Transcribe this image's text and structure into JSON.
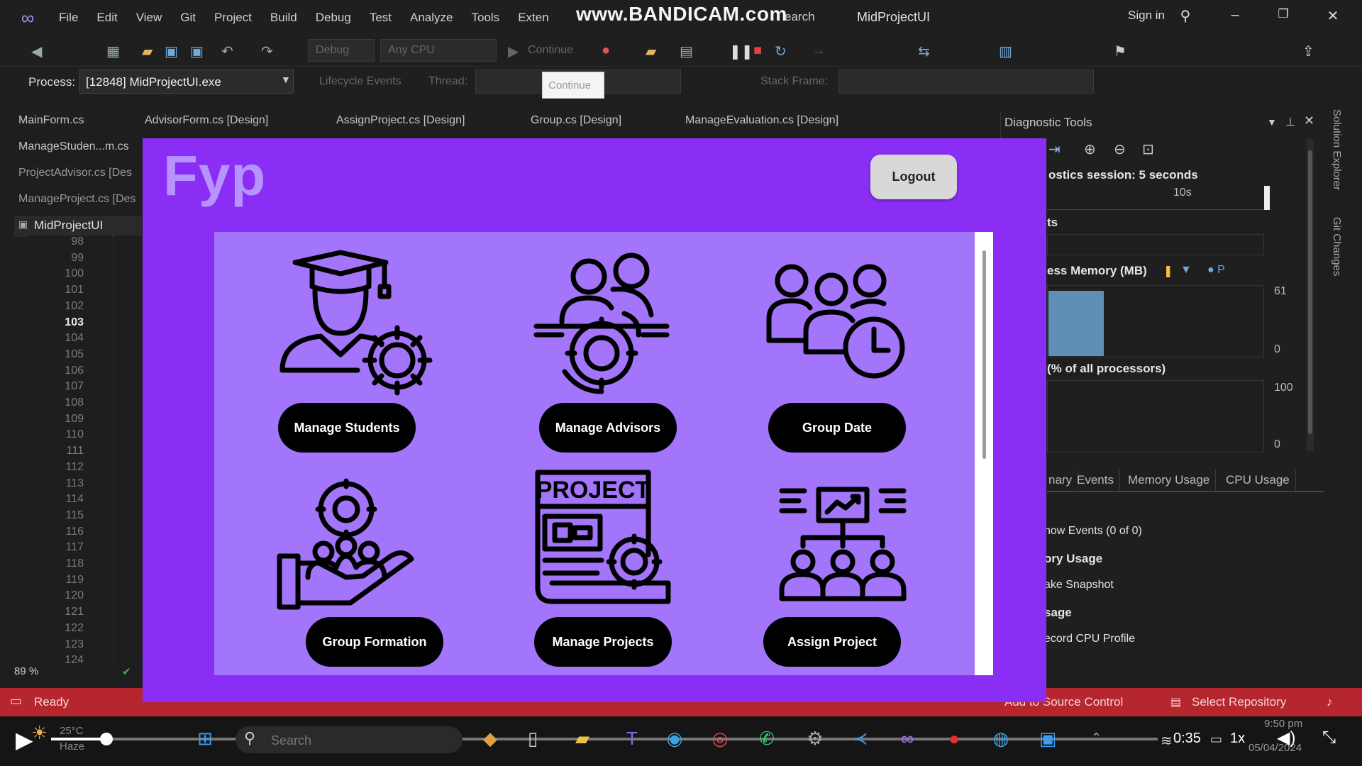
{
  "ide": {
    "menu": [
      "File",
      "Edit",
      "View",
      "Git",
      "Project",
      "Build",
      "Debug",
      "Test",
      "Analyze",
      "Tools",
      "Exten"
    ],
    "watermark": "www.BANDICAM.com",
    "search_fragment": "earch",
    "title": "MidProjectUI",
    "sign_in": "Sign in",
    "toolbar": {
      "debug": "Debug",
      "cpu": "Any CPU",
      "continue": "Continue"
    },
    "process_label": "Process:",
    "process_value": "[12848] MidProjectUI.exe",
    "lifecycle": "Lifecycle Events",
    "thread_label": "Thread:",
    "tooltip": "Continue",
    "stack_frame": "Stack Frame:"
  },
  "tabs": [
    "MainForm.cs",
    "AdvisorForm.cs [Design]",
    "AssignProject.cs [Design]",
    "Group.cs [Design]",
    "ManageEvaluation.cs [Design]"
  ],
  "side_tabs": [
    "ManageStuden...m.cs",
    "ProjectAdvisor.cs [Des",
    "ManageProject.cs [Des"
  ],
  "solution_node": "MidProjectUI",
  "line_numbers": [
    "98",
    "99",
    "100",
    "101",
    "102",
    "103",
    "104",
    "105",
    "106",
    "107",
    "108",
    "109",
    "110",
    "111",
    "112",
    "113",
    "114",
    "115",
    "116",
    "117",
    "118",
    "119",
    "120",
    "121",
    "122",
    "123",
    "124"
  ],
  "current_line": "103",
  "zoom": "89 %",
  "diagnostics": {
    "title": "Diagnostic Tools",
    "session": "ostics session: 5 seconds",
    "time_tick": "10s",
    "events": "ts",
    "memory": "ess Memory (MB)",
    "mem_max": "61",
    "mem_min": "0",
    "cpu": "(% of all processors)",
    "cpu_max": "100",
    "cpu_min": "0",
    "tabs": [
      "nary",
      "Events",
      "Memory Usage",
      "CPU Usage"
    ],
    "items": [
      "how Events (0 of 0)",
      "ory Usage",
      "ake Snapshot",
      "sage",
      "ecord CPU Profile"
    ],
    "vertical": [
      "Solution Explorer",
      "Git Changes"
    ]
  },
  "status": {
    "ready": "Ready",
    "source_control": "Add to Source Control",
    "repo": "Select Repository"
  },
  "player": {
    "temp": "25°C",
    "weather": "Haze",
    "search": "Search",
    "time_elapsed": "0:35",
    "speed": "1x",
    "clock": "9:50 pm",
    "date": "05/04/2024",
    "progress": 0.05
  },
  "app": {
    "title": "Fyp",
    "logout": "Logout",
    "tiles": [
      {
        "label": "Manage Students",
        "icon": "student-gear-icon"
      },
      {
        "label": "Manage Advisors",
        "icon": "advisors-gear-icon"
      },
      {
        "label": "Group  Date",
        "icon": "group-clock-icon"
      },
      {
        "label": "Group Formation",
        "icon": "hand-group-icon"
      },
      {
        "label": "Manage Projects",
        "icon": "project-document-icon"
      },
      {
        "label": "Assign Project",
        "icon": "presentation-team-icon"
      }
    ]
  }
}
